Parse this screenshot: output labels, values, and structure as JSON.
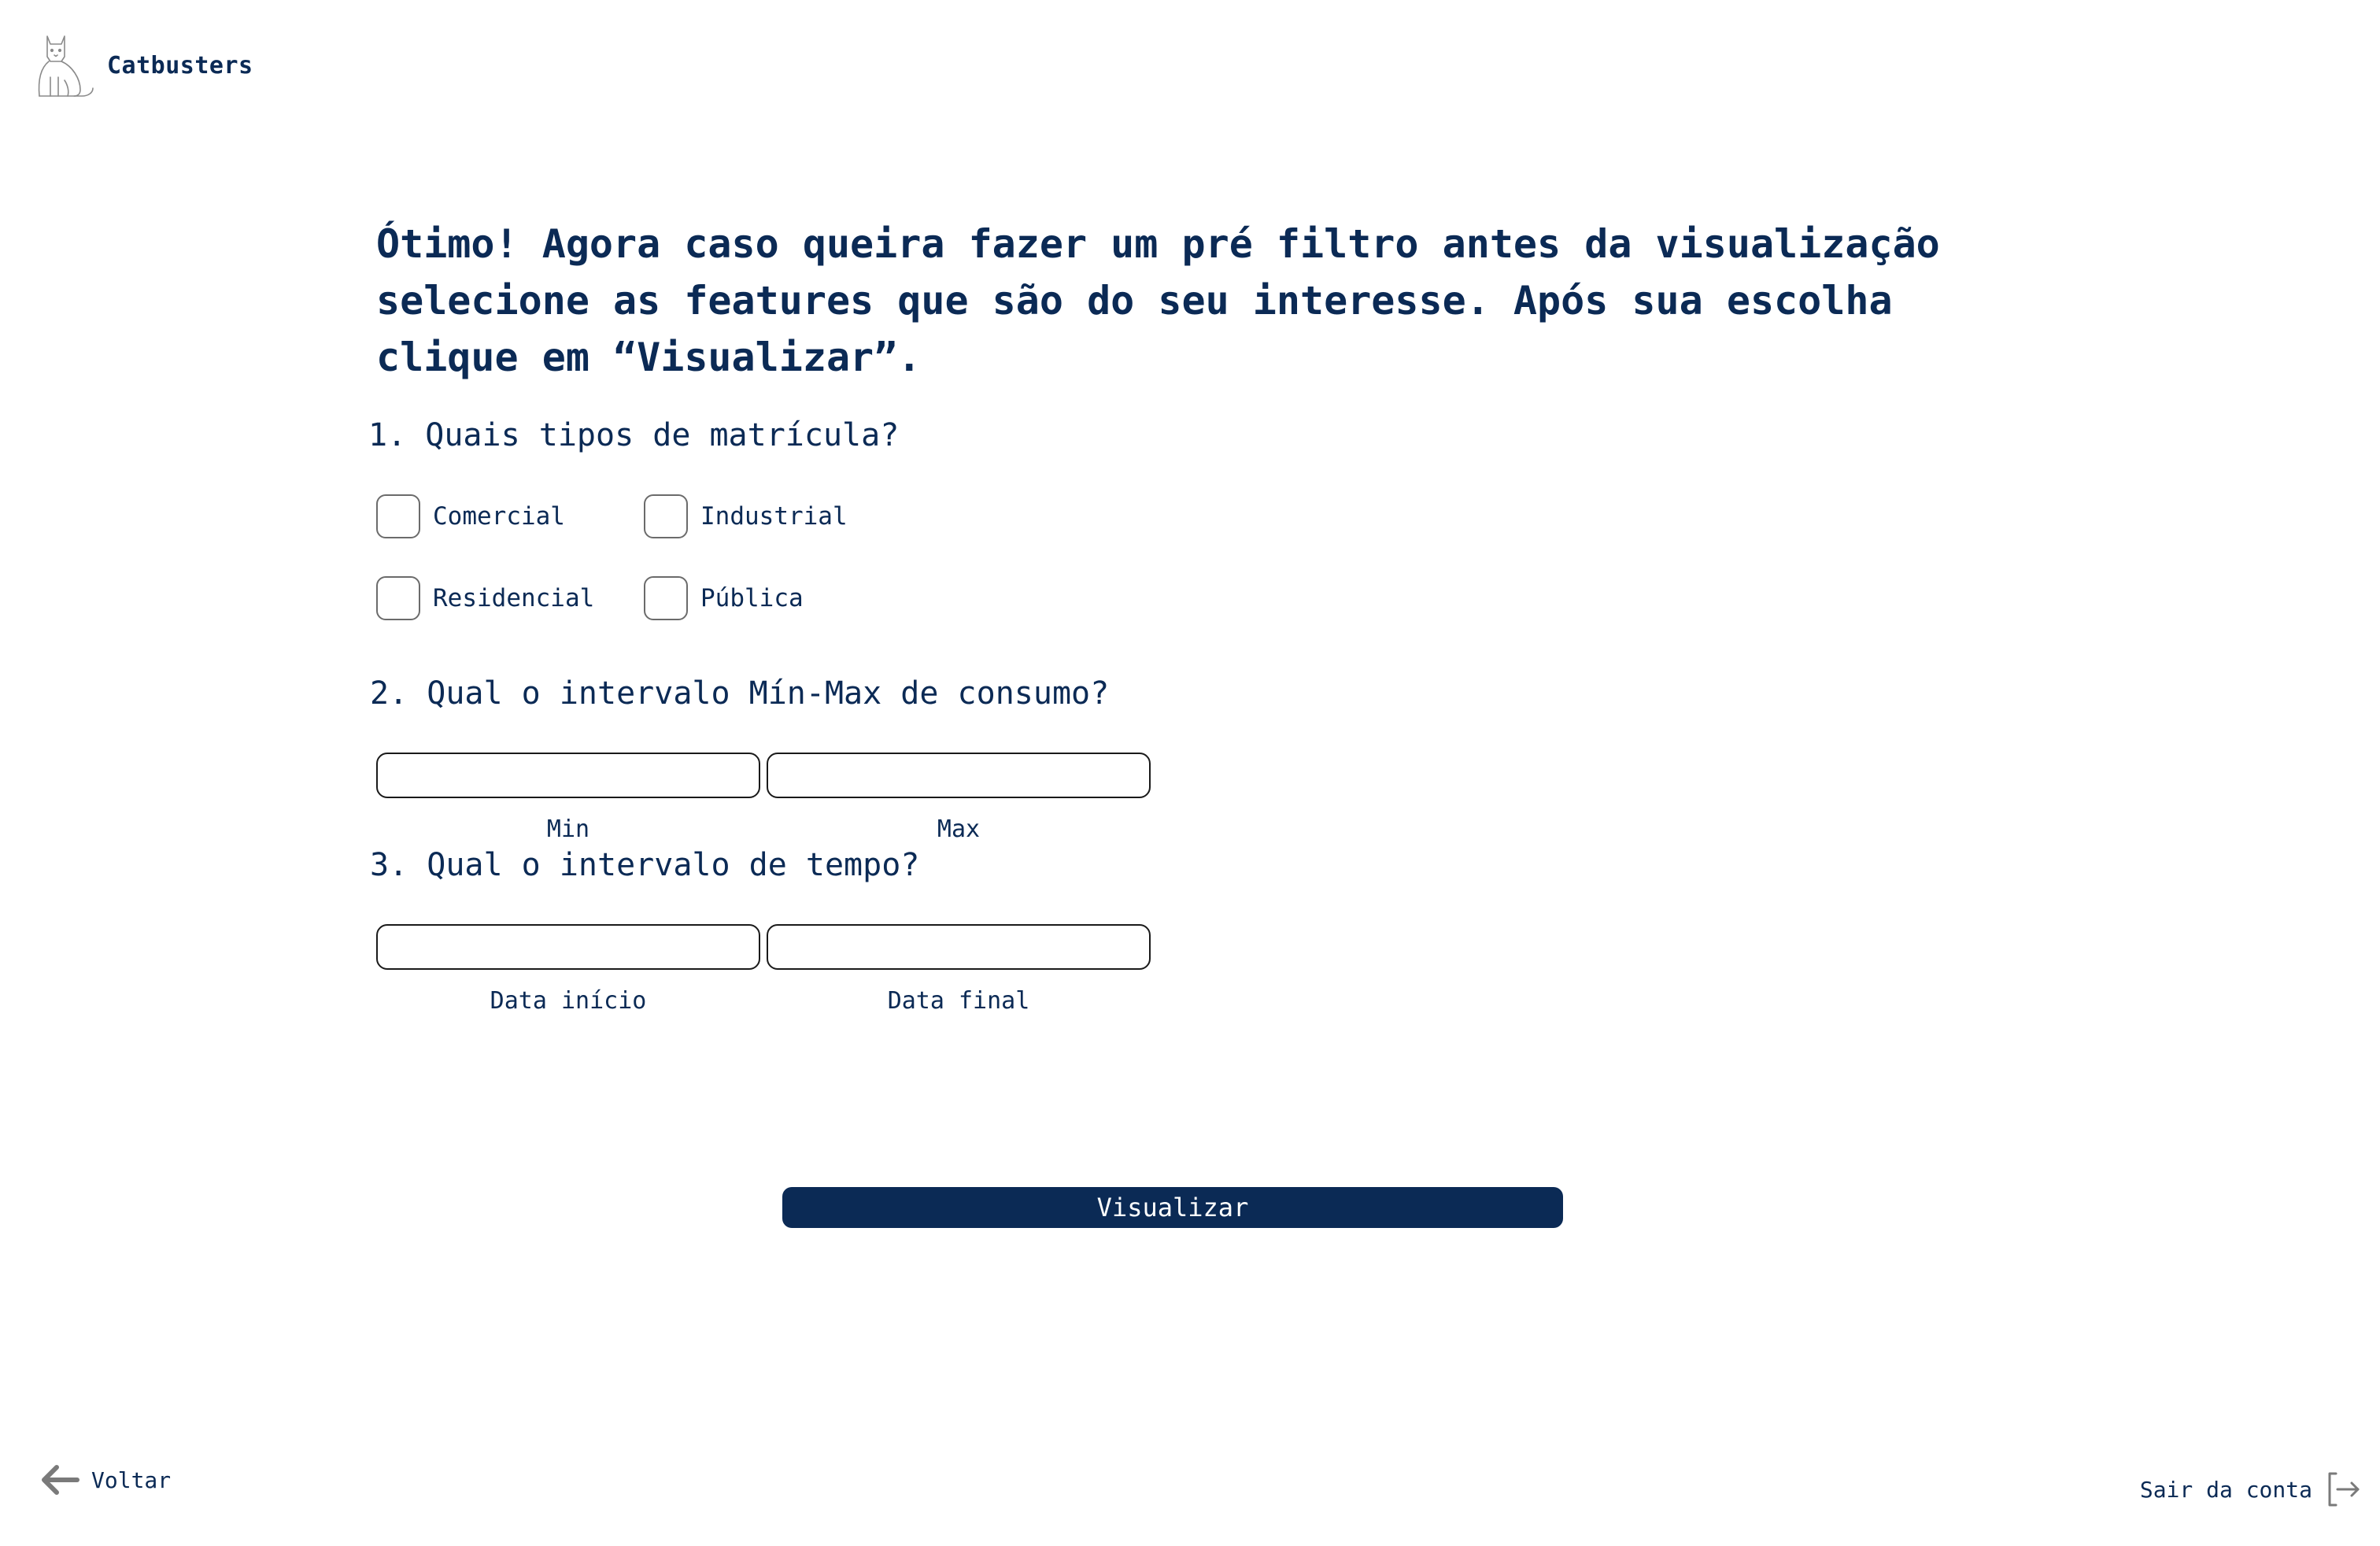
{
  "brand": {
    "name": "Catbusters",
    "logo_icon": "cat-logo-icon"
  },
  "intro": {
    "text": "Ótimo! Agora caso queira fazer um pré filtro antes da visualização selecione as features que são do seu interesse. Após sua escolha clique em “Visualizar”."
  },
  "questions": {
    "q1": {
      "label": "1. Quais tipos de matrícula?",
      "options": [
        {
          "label": "Comercial",
          "checked": false
        },
        {
          "label": "Industrial",
          "checked": false
        },
        {
          "label": "Residencial",
          "checked": false
        },
        {
          "label": "Pública",
          "checked": false
        }
      ]
    },
    "q2": {
      "label": "2. Qual o intervalo Mín-Max de consumo?",
      "min_label": "Min",
      "max_label": "Max",
      "min_value": "",
      "max_value": ""
    },
    "q3": {
      "label": "3. Qual o intervalo de tempo?",
      "start_label": "Data início",
      "end_label": "Data final",
      "start_value": "",
      "end_value": ""
    }
  },
  "actions": {
    "visualize_label": "Visualizar",
    "back_label": "Voltar",
    "back_icon": "arrow-left-icon",
    "logout_label": "Sair da conta",
    "logout_icon": "logout-icon"
  },
  "colors": {
    "primary": "#0b2a55",
    "checkbox_border": "#6b6b6b",
    "icon_gray": "#7a7a7a"
  }
}
